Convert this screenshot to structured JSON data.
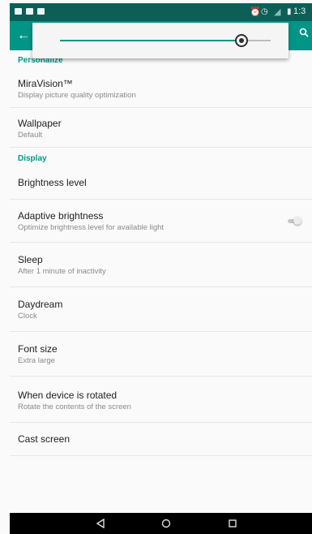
{
  "status_bar": {
    "time": "1:3",
    "icons": [
      "notification-icon",
      "notification-icon",
      "notification-icon"
    ],
    "right_icons": [
      "alarm-icon",
      "clock-icon",
      "signal-icon",
      "battery-icon"
    ]
  },
  "action_bar": {
    "back_icon": "arrow-left-icon",
    "search_icon": "search-icon",
    "accent_color": "#009587"
  },
  "brightness": {
    "level_percent": 86,
    "accent_color": "#009688"
  },
  "sections": [
    {
      "category": "Personalize",
      "items": [
        {
          "title": "MiraVision™",
          "summary": "Display picture quality optimization"
        },
        {
          "title": "Wallpaper",
          "summary": "Default"
        }
      ]
    },
    {
      "category": "Display",
      "items": [
        {
          "title": "Brightness level",
          "summary": ""
        },
        {
          "title": "Adaptive brightness",
          "summary": "Optimize brightness level for available light",
          "toggle": false
        },
        {
          "title": "Sleep",
          "summary": "After 1 minute of inactivity"
        },
        {
          "title": "Daydream",
          "summary": "Clock"
        },
        {
          "title": "Font size",
          "summary": "Extra large"
        },
        {
          "title": "When device is rotated",
          "summary": "Rotate the contents of the screen"
        },
        {
          "title": "Cast screen",
          "summary": ""
        }
      ]
    }
  ],
  "nav_bar": {
    "back_icon": "triangle-back-icon",
    "home_icon": "circle-home-icon",
    "recents_icon": "square-recents-icon"
  }
}
